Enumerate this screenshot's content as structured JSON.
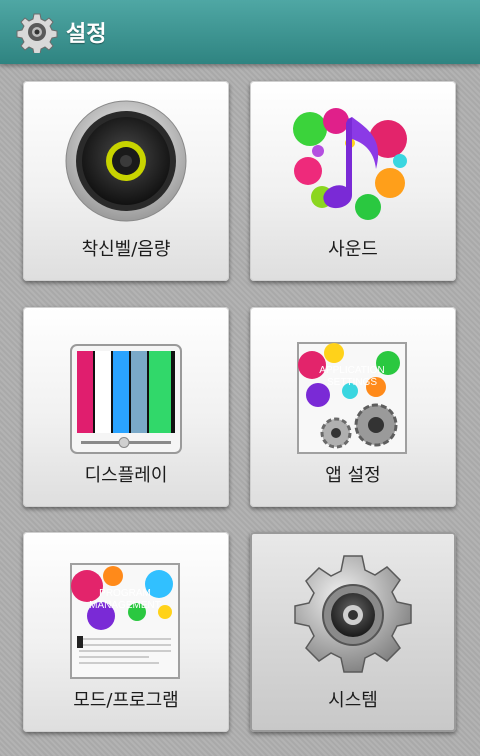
{
  "header": {
    "title": "설정",
    "icon": "gear-icon"
  },
  "tiles": [
    {
      "label": "착신벨/음량",
      "icon": "speaker-icon"
    },
    {
      "label": "사운드",
      "icon": "music-note-icon"
    },
    {
      "label": "디스플레이",
      "icon": "display-icon"
    },
    {
      "label": "앱 설정",
      "icon": "app-settings-icon",
      "art_text": [
        "APPLICATION",
        "SETTINGS"
      ]
    },
    {
      "label": "모드/프로그램",
      "icon": "program-management-icon",
      "art_text": [
        "PROGRAM",
        "MANAGEMENT"
      ]
    },
    {
      "label": "시스템",
      "icon": "system-gear-icon"
    }
  ]
}
